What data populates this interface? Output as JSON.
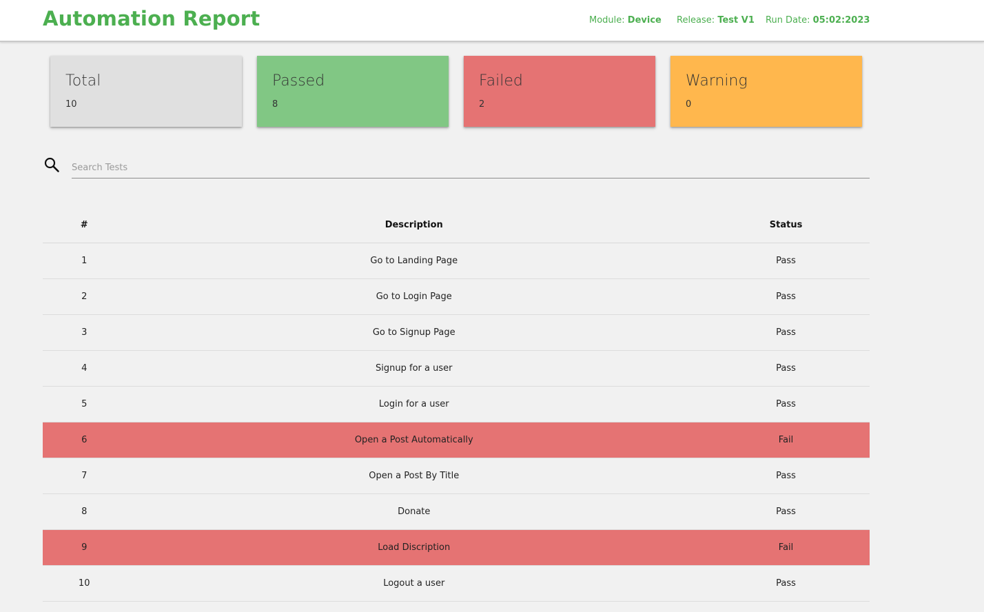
{
  "header": {
    "title": "Automation Report",
    "module_label": "Module:",
    "module_value": "Device",
    "release_label": "Release:",
    "release_value": "Test V1",
    "run_date_label": "Run Date:",
    "run_date_value": "05:02:2023",
    "accent_color": "#4caf50"
  },
  "summary": [
    {
      "title": "Total",
      "value": "10",
      "color": "#e0e0e0"
    },
    {
      "title": "Passed",
      "value": "8",
      "color": "#81c784"
    },
    {
      "title": "Failed",
      "value": "2",
      "color": "#e57373"
    },
    {
      "title": "Warning",
      "value": "0",
      "color": "#ffb74d"
    }
  ],
  "search": {
    "icon": "search-icon",
    "placeholder": "Search Tests",
    "value": ""
  },
  "table": {
    "headers": {
      "num": "#",
      "description": "Description",
      "status": "Status"
    },
    "fail_row_color": "#e57373",
    "rows": [
      {
        "num": "1",
        "description": "Go to Landing Page",
        "status": "Pass"
      },
      {
        "num": "2",
        "description": "Go to Login Page",
        "status": "Pass"
      },
      {
        "num": "3",
        "description": "Go to Signup Page",
        "status": "Pass"
      },
      {
        "num": "4",
        "description": "Signup for a user",
        "status": "Pass"
      },
      {
        "num": "5",
        "description": "Login for a user",
        "status": "Pass"
      },
      {
        "num": "6",
        "description": "Open a Post Automatically",
        "status": "Fail"
      },
      {
        "num": "7",
        "description": "Open a Post By Title",
        "status": "Pass"
      },
      {
        "num": "8",
        "description": "Donate",
        "status": "Pass"
      },
      {
        "num": "9",
        "description": "Load Discription",
        "status": "Fail"
      },
      {
        "num": "10",
        "description": "Logout a user",
        "status": "Pass"
      }
    ]
  }
}
